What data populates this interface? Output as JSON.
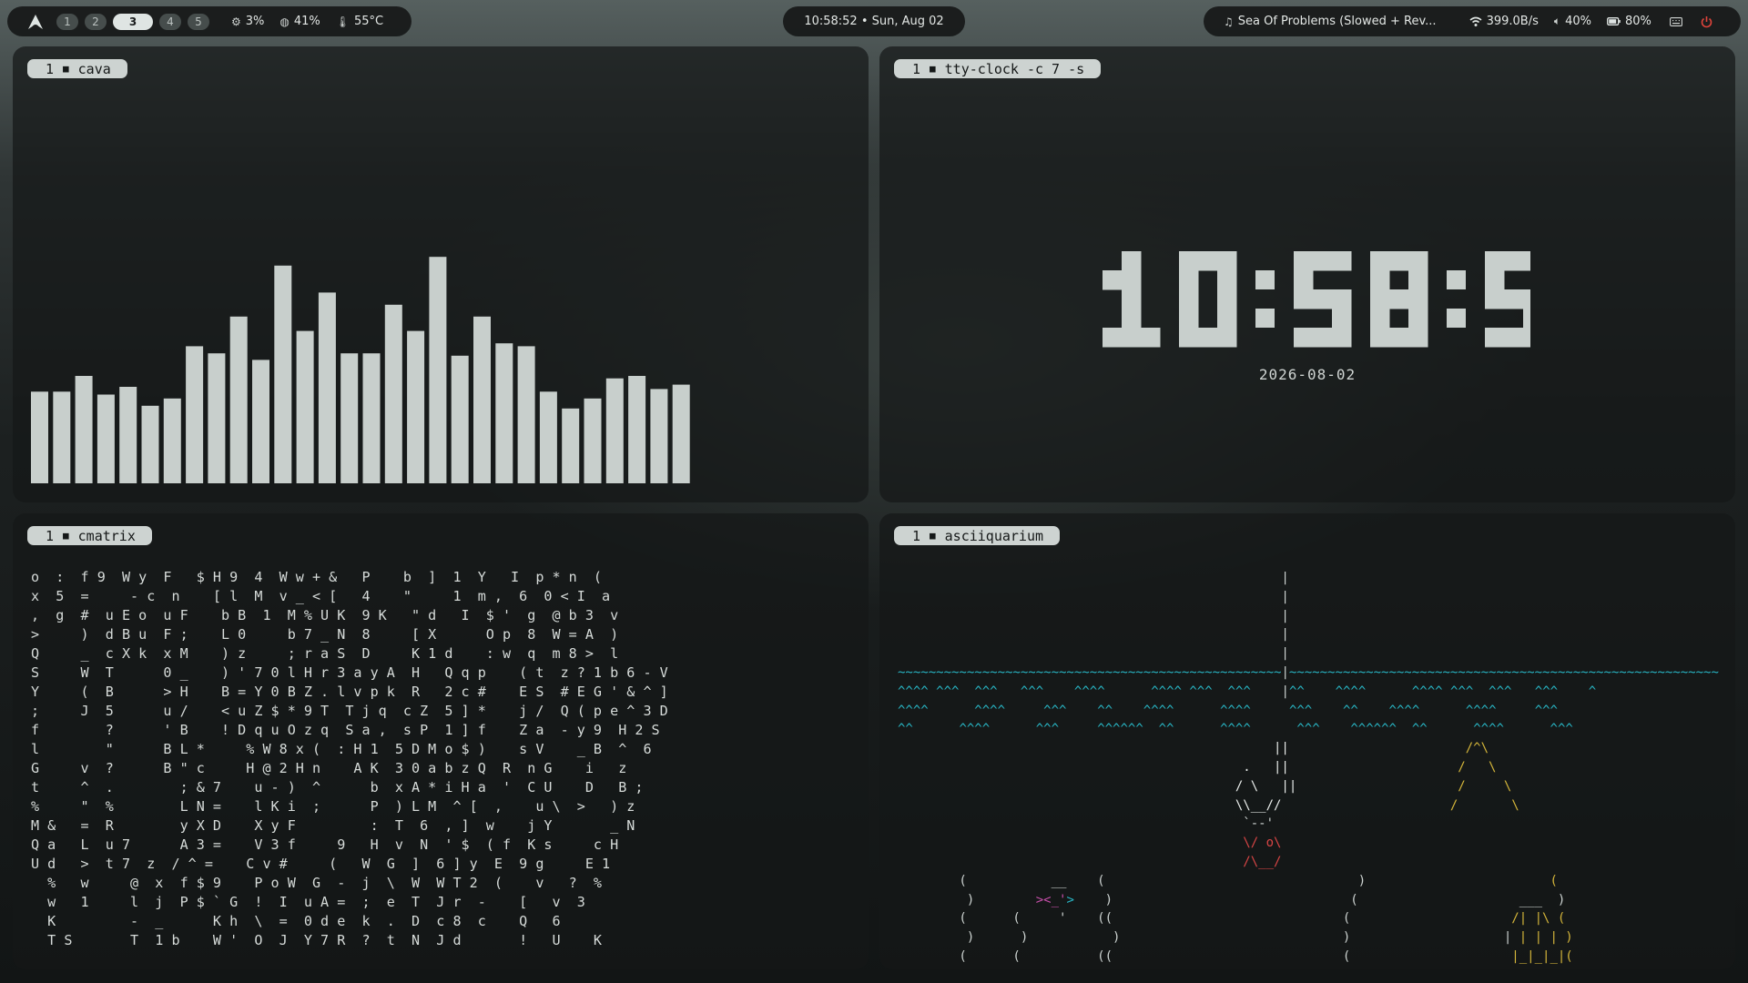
{
  "topbar": {
    "workspaces": [
      "1",
      "2",
      "3",
      "4",
      "5"
    ],
    "active_workspace": "3",
    "cpu": "3%",
    "memory": "41%",
    "temperature": "55°C",
    "clock": "10:58:52 • Sun, Aug 02",
    "media": "Sea Of Problems (Slowed + Rev...",
    "network": "399.0B/s",
    "volume": "40%",
    "battery": "80%"
  },
  "windows": {
    "cava": {
      "workspace": "1",
      "title": "cava"
    },
    "clock": {
      "workspace": "1",
      "title": "tty-clock -c 7 -s"
    },
    "matrix": {
      "workspace": "1",
      "title": "cmatrix"
    },
    "aqua": {
      "workspace": "1",
      "title": "asciiquarium"
    }
  },
  "cava": {
    "bar_color": "#c8cfcc",
    "levels": [
      0.377,
      0.377,
      0.442,
      0.365,
      0.397,
      0.319,
      0.349,
      0.564,
      0.535,
      0.686,
      0.508,
      0.896,
      0.627,
      0.785,
      0.535,
      0.535,
      0.735,
      0.627,
      0.932,
      0.525,
      0.686,
      0.576,
      0.564,
      0.377,
      0.308,
      0.349,
      0.432,
      0.442,
      0.388,
      0.406
    ]
  },
  "clock": {
    "time": "10:58:52",
    "date": "2026-08-02"
  },
  "matrix": {
    "lines": [
      "o  :  f 9  W y  F   $ H 9  4  W w + &   P    b  ]  1  Y   I  p * n  (",
      "x  5  =     - c  n    [ l  M  v _ < [   4    \"     1  m ,  6  0 < I  a",
      ",  g  #  u E o  u F    b B  1  M % U K  9 K   \" d   I  $ '  g  @ b 3  v",
      ">     )  d B u  F ;    L 0     b 7 _ N  8     [ X      O p  8  W = A  )",
      "Q     _  c X k  x M    ) z     ; r a S  D     K 1 d    : w  q  m 8 >  l",
      "S     W  T      0 _    ) ' 7 0 l H r 3 a y A  H   Q q p    ( t  z ? 1 b 6 - V",
      "Y     (  B      > H    B = Y 0 B Z . l v p k  R   2 c #    E S  # E G ' & ^ ]",
      ";     J  5      u /    < u Z $ * 9 T  T j q  c Z  5 ] *    j /  Q ( p e ^ 3 D",
      "f        ?      ' B    ! D q u O z q  S a ,  s P  1 ] f    Z a  - y 9  H 2 S",
      "l        \"      B L *     % W 8 x (  : H 1  5 D M o $ )    s V    _ B  ^  6",
      "G     v  ?      B \" c     H @ 2 H n    A K  3 0 a b z Q  R  n G    i   z",
      "t     ^  .        ; & 7    u - )  ^      b  x A * i H a  '  C U    D   B ;",
      "%     \"  %        L N =    l K i  ;      P  ) L M  ^ [  ,    u \\  >   ) z",
      "M &   =  R        y X D    X y F         :  T  6  , ]  w    j Y       _ N",
      "Q a   L  u 7      A 3 =    V 3 f     9   H  v  N  ' $  ( f  K s     c H",
      "U d   >  t 7  z  / ^ =    C v #     (   W  G  ]  6 ] y  E  9 g     E 1",
      "  %   w     @  x  f $ 9    P o W  G  -  j  \\  W  W T 2  (    v   ?  %",
      "  w   1     l  j  P $ ` G  !  I  u A =  ;  e  T  J r  -    [   v  3",
      "  K         -  _      K h  \\  =  0 d e  k  .  D  c 8  c    Q   6",
      "  T S       T  1 b    W '  O  J  Y 7 R  ?  t  N  J d       !   U    K"
    ]
  },
  "aqua": {
    "lines": [
      "                                                  |",
      "                                                  |",
      "                                                  |",
      "                                                  |",
      "                                                  |",
      "~~~~~~~~~~~~~~~~~~~~~~~~~~~~~~~~~~~~~~~~~~~~~~~~~~|~~~~~~~~~~~~~~~~~~~~~~~~~~~~~~~~~~~~~~~~~~~~~~~~~~~~~~~~",
      "^^^^ ^^^  ^^^   ^^^    ^^^^      ^^^^ ^^^  ^^^    |^^    ^^^^      ^^^^ ^^^  ^^^   ^^^    ^",
      "^^^^      ^^^^     ^^^    ^^    ^^^^      ^^^^     ^^^    ^^    ^^^^      ^^^^     ^^^",
      "^^      ^^^^      ^^^     ^^^^^^  ^^      ^^^^      ^^^    ^^^^^^  ^^      ^^^^      ^^^",
      "                                                 ||                       /^\\",
      "                                             .   ||                      /   \\",
      "                                            / \\   ||                     /     \\",
      "                                            \\\\__//                      /       \\",
      "                                             `--'",
      "                                             \\/ o\\",
      "                                             /\\__/",
      "        (           __    (                                 )                        (",
      "         )        ><_'>    )                               (                     ___  )",
      "        (      (     '    ((                              (                     /| |\\ (",
      "         )      )           )                             )                    | | | | )",
      "        (      (          ((                              (                     |_|_|_|("
    ]
  }
}
